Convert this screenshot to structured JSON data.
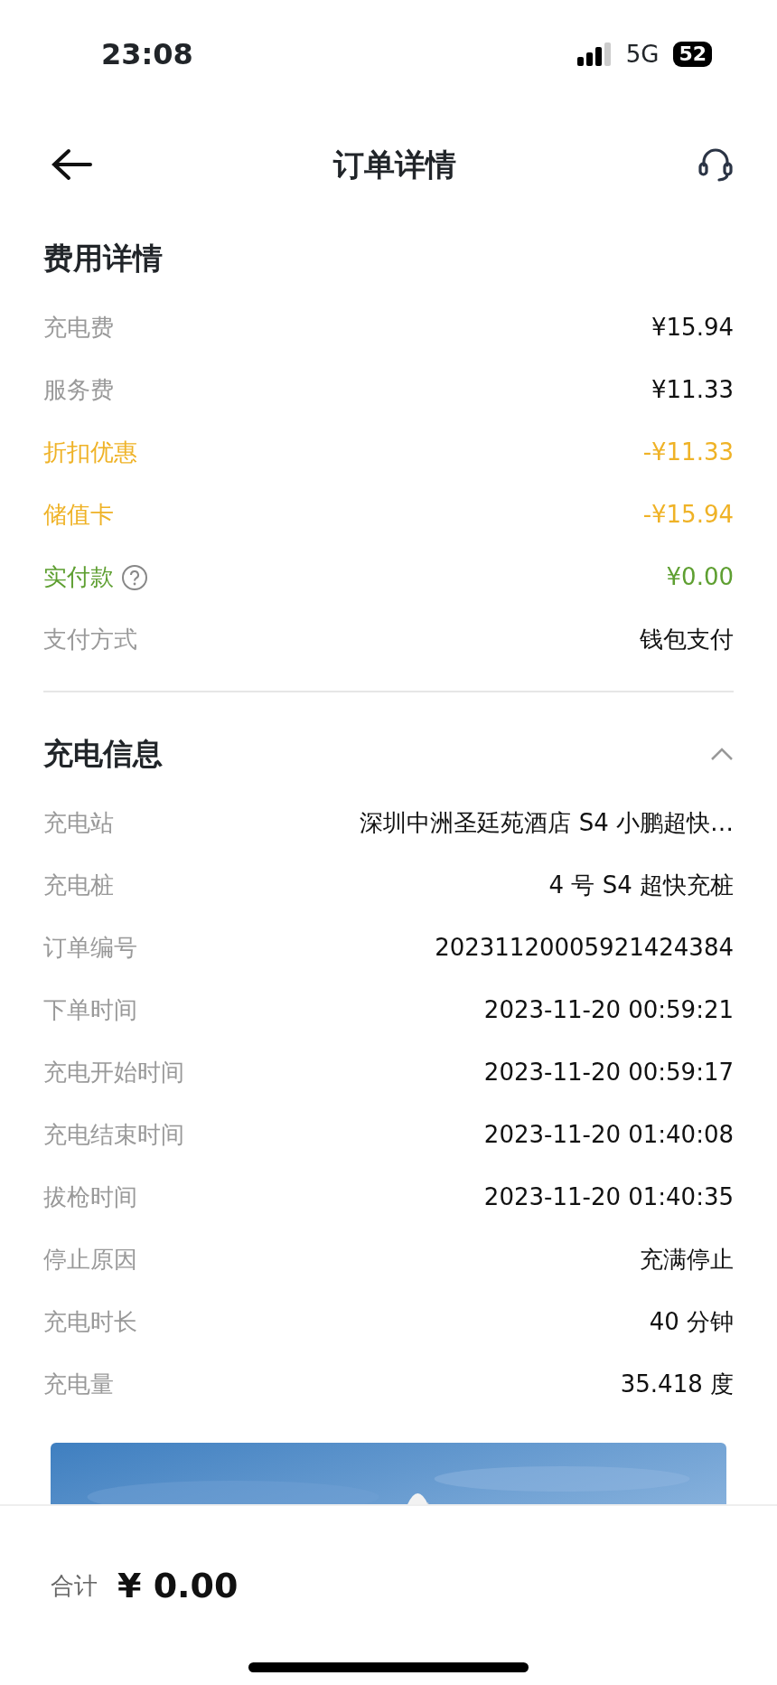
{
  "status_bar": {
    "time": "23:08",
    "network": "5G",
    "battery": "52"
  },
  "header": {
    "title": "订单详情"
  },
  "fee_section": {
    "title": "费用详情",
    "rows": [
      {
        "label": "充电费",
        "value": "¥15.94",
        "kind": "plain"
      },
      {
        "label": "服务费",
        "value": "¥11.33",
        "kind": "plain"
      },
      {
        "label": "折扣优惠",
        "value": "-¥11.33",
        "kind": "discount"
      },
      {
        "label": "储值卡",
        "value": "-¥15.94",
        "kind": "discount"
      },
      {
        "label": "实付款",
        "value": "¥0.00",
        "kind": "paid"
      },
      {
        "label": "支付方式",
        "value": "钱包支付",
        "kind": "plain"
      }
    ]
  },
  "charge_section": {
    "title": "充电信息",
    "expanded": true,
    "rows": [
      {
        "label": "充电站",
        "value": "深圳中洲圣廷苑酒店 S4 小鹏超快…"
      },
      {
        "label": "充电桩",
        "value": "4 号 S4 超快充桩"
      },
      {
        "label": "订单编号",
        "value": "20231120005921424384"
      },
      {
        "label": "下单时间",
        "value": "2023-11-20 00:59:21"
      },
      {
        "label": "充电开始时间",
        "value": "2023-11-20 00:59:17"
      },
      {
        "label": "充电结束时间",
        "value": "2023-11-20 01:40:08"
      },
      {
        "label": "拔枪时间",
        "value": "2023-11-20 01:40:35"
      },
      {
        "label": "停止原因",
        "value": "充满停止"
      },
      {
        "label": "充电时长",
        "value": "40 分钟"
      },
      {
        "label": "充电量",
        "value": "35.418 度"
      }
    ]
  },
  "footer": {
    "label": "合计",
    "total": "¥ 0.00"
  }
}
